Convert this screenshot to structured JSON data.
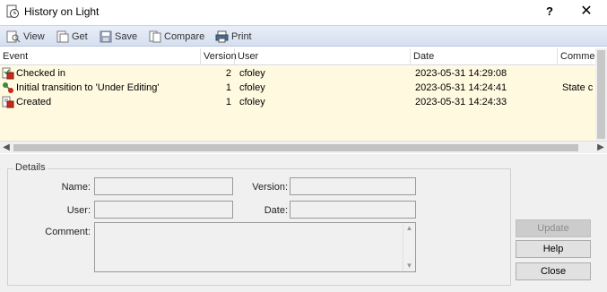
{
  "window": {
    "title": "History on Light",
    "help_label": "?",
    "close_label": "✕"
  },
  "toolbar": {
    "view": "View",
    "get": "Get",
    "save": "Save",
    "compare": "Compare",
    "print": "Print"
  },
  "grid": {
    "columns": [
      "Event",
      "Version",
      "User",
      "Date",
      "Comme"
    ],
    "rows": [
      {
        "event": "Checked in",
        "version": "2",
        "user": "cfoley",
        "date": "2023-05-31 14:29:08",
        "comment": ""
      },
      {
        "event": "Initial transition to 'Under Editing'",
        "version": "1",
        "user": "cfoley",
        "date": "2023-05-31 14:24:41",
        "comment": "State c"
      },
      {
        "event": "Created",
        "version": "1",
        "user": "cfoley",
        "date": "2023-05-31 14:24:33",
        "comment": ""
      }
    ]
  },
  "details": {
    "legend": "Details",
    "name_label": "Name:",
    "version_label": "Version:",
    "user_label": "User:",
    "date_label": "Date:",
    "comment_label": "Comment:",
    "name_value": "",
    "version_value": "",
    "user_value": "",
    "date_value": "",
    "comment_value": ""
  },
  "buttons": {
    "update": "Update",
    "help": "Help",
    "close": "Close"
  },
  "colors": {
    "row_highlight": "#fff9e0",
    "toolbar": "#dde5f3"
  }
}
